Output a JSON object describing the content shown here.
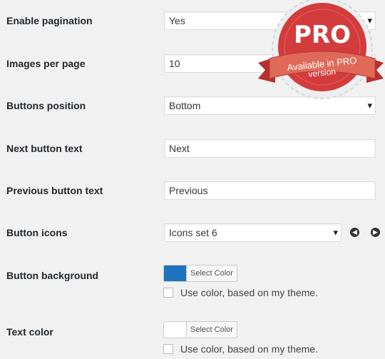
{
  "rows": {
    "pagination": {
      "label": "Enable pagination",
      "value": "Yes"
    },
    "images_per_page": {
      "label": "Images per page",
      "value": "10"
    },
    "buttons_position": {
      "label": "Buttons position",
      "value": "Bottom"
    },
    "next_text": {
      "label": "Next button text",
      "value": "Next"
    },
    "prev_text": {
      "label": "Previous button text",
      "value": "Previous"
    },
    "button_icons": {
      "label": "Button icons",
      "value": "Icons set 6"
    },
    "button_background": {
      "label": "Button background",
      "select_color": "Select Color",
      "swatch_color": "#1e73be",
      "checkbox_label": "Use color, based on my theme."
    },
    "text_color": {
      "label": "Text color",
      "select_color": "Select Color",
      "swatch_color": "#ffffff",
      "checkbox_label": "Use color, based on my theme."
    }
  },
  "pro_badge": {
    "title": "PRO",
    "line1": "Available in PRO",
    "line2": "version"
  },
  "icons": {
    "prev": "chevron-left-icon",
    "next": "chevron-right-icon",
    "dropdown": "caret-down-icon"
  }
}
